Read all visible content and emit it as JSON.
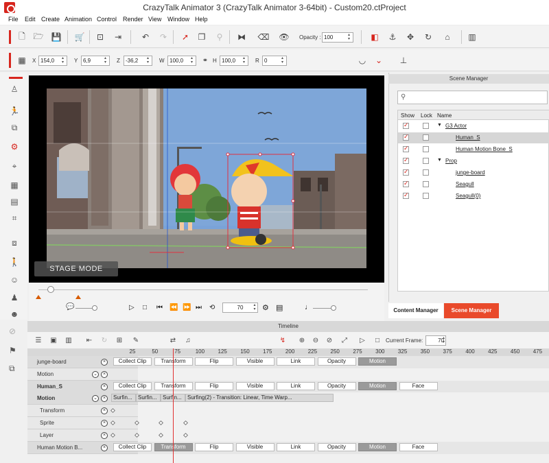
{
  "window": {
    "title": "CrazyTalk Animator 3  (CrazyTalk Animator 3-64bit) - Custom20.ctProject"
  },
  "menu": [
    "File",
    "Edit",
    "Create",
    "Animation",
    "Control",
    "Render",
    "View",
    "Window",
    "Help"
  ],
  "toolbar": {
    "opacity_label": "Opacity :",
    "opacity_value": "100"
  },
  "transform": {
    "x_label": "X",
    "x_value": "154,0",
    "y_label": "Y",
    "y_value": "6,9",
    "z_label": "Z",
    "z_value": "-36,2",
    "w_label": "W",
    "w_value": "100,0",
    "h_label": "H",
    "h_value": "100,0",
    "r_label": "R",
    "r_value": "0"
  },
  "stage": {
    "mode_label": "STAGE MODE"
  },
  "playback": {
    "frame_value": "70"
  },
  "scene_manager": {
    "title": "Scene Manager",
    "columns": {
      "show": "Show",
      "lock": "Lock",
      "name": "Name"
    },
    "rows": [
      {
        "name": "G3 Actor",
        "level": 0,
        "group": true,
        "selected": false
      },
      {
        "name": "Human_S",
        "level": 1,
        "group": false,
        "selected": true
      },
      {
        "name": "Human Motion Bone_S",
        "level": 1,
        "group": false,
        "selected": false
      },
      {
        "name": "Prop",
        "level": 0,
        "group": true,
        "selected": false
      },
      {
        "name": "junge-board",
        "level": 1,
        "group": false,
        "selected": false
      },
      {
        "name": "Seagull",
        "level": 1,
        "group": false,
        "selected": false
      },
      {
        "name": "Seagull(0)",
        "level": 1,
        "group": false,
        "selected": false
      }
    ],
    "tabs": {
      "content": "Content Manager",
      "scene": "Scene Manager"
    }
  },
  "timeline": {
    "title": "Timeline",
    "current_frame_label": "Current Frame:",
    "current_frame_value": "70",
    "ruler": [
      "25",
      "50",
      "75",
      "100",
      "125",
      "150",
      "175",
      "200",
      "225",
      "250",
      "275",
      "300",
      "325",
      "350",
      "375",
      "400",
      "425",
      "450",
      "475"
    ],
    "tracks": [
      {
        "name": "junge-board",
        "buttons": [
          "Collect Clip",
          "Transform",
          "Flip",
          "Visible",
          "Link",
          "Opacity",
          "Motion"
        ],
        "active": [
          "Motion"
        ]
      },
      {
        "name": "Motion",
        "sub": true
      },
      {
        "name": "Human_S",
        "bold": true,
        "buttons": [
          "Collect Clip",
          "Transform",
          "Flip",
          "Visible",
          "Link",
          "Opacity",
          "Motion",
          "Face"
        ],
        "active": [
          "Motion"
        ]
      },
      {
        "name": "Motion",
        "bold": true,
        "clips": [
          "Surfin...",
          "Surfin...",
          "Surfin...",
          "Surfing(2) - Transition: Linear, Time Warp..."
        ]
      },
      {
        "name": "Transform",
        "indent": true
      },
      {
        "name": "Sprite",
        "indent": true
      },
      {
        "name": "Layer",
        "indent": true
      },
      {
        "name": "Human Motion B...",
        "buttons": [
          "Collect Clip",
          "Transform",
          "Flip",
          "Visible",
          "Link",
          "Opacity",
          "Motion",
          "Face"
        ],
        "active": [
          "Transform",
          "Motion"
        ]
      }
    ]
  },
  "colors": {
    "accent": "#d7261e",
    "selected_row": "#d6d6d6"
  }
}
